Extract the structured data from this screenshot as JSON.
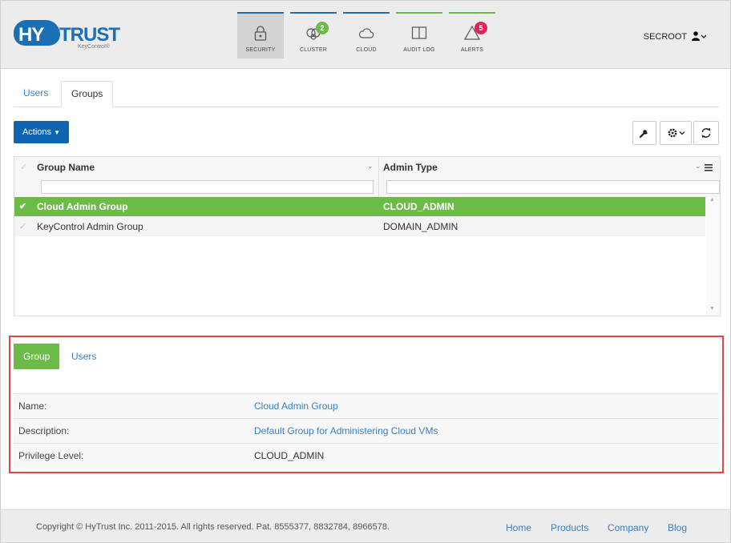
{
  "brand": {
    "logo_hy": "HY",
    "logo_trust": "TRUST",
    "logo_sub": "KeyControl®"
  },
  "nav": [
    {
      "label": "SECURITY",
      "icon": "lock-icon",
      "active": true,
      "bar_color": "#1b6fb5"
    },
    {
      "label": "CLUSTER",
      "icon": "cluster-icon",
      "badge": "2",
      "badge_color": "#6cbb48",
      "bar_color": "#1b6fb5"
    },
    {
      "label": "CLOUD",
      "icon": "cloud-icon",
      "bar_color": "#1b6fb5"
    },
    {
      "label": "AUDIT LOG",
      "icon": "book-icon",
      "bar_color": "#6cbb48"
    },
    {
      "label": "ALERTS",
      "icon": "alert-icon",
      "badge": "5",
      "badge_color": "#e0245e",
      "bar_color": "#6cbb48"
    }
  ],
  "user": {
    "name": "SECROOT"
  },
  "tabs": [
    {
      "label": "Users",
      "active": false
    },
    {
      "label": "Groups",
      "active": true
    }
  ],
  "toolbar": {
    "actions_label": "Actions",
    "buttons": [
      "wrench-icon",
      "gear-icon",
      "refresh-icon"
    ]
  },
  "grid": {
    "columns": [
      "Group Name",
      "Admin Type"
    ],
    "rows": [
      {
        "name": "Cloud Admin Group",
        "type": "CLOUD_ADMIN",
        "selected": true
      },
      {
        "name": "KeyControl Admin Group",
        "type": "DOMAIN_ADMIN",
        "selected": false
      }
    ]
  },
  "detail": {
    "tabs": [
      {
        "label": "Group",
        "active": true
      },
      {
        "label": "Users",
        "active": false
      }
    ],
    "fields": [
      {
        "key": "Name:",
        "value": "Cloud Admin Group",
        "link": true
      },
      {
        "key": "Description:",
        "value": "Default Group for Administering Cloud VMs",
        "link": true
      },
      {
        "key": "Privilege Level:",
        "value": "CLOUD_ADMIN",
        "link": false
      }
    ]
  },
  "footer": {
    "copyright": "Copyright © HyTrust Inc. 2011-2015. All rights reserved. Pat. 8555377, 8832784, 8966578.",
    "links": [
      "Home",
      "Products",
      "Company",
      "Blog"
    ]
  },
  "colors": {
    "primary": "#0e64ae",
    "accent_green": "#6cbb48",
    "highlight_border": "#e04545",
    "link": "#3a7fc2"
  }
}
